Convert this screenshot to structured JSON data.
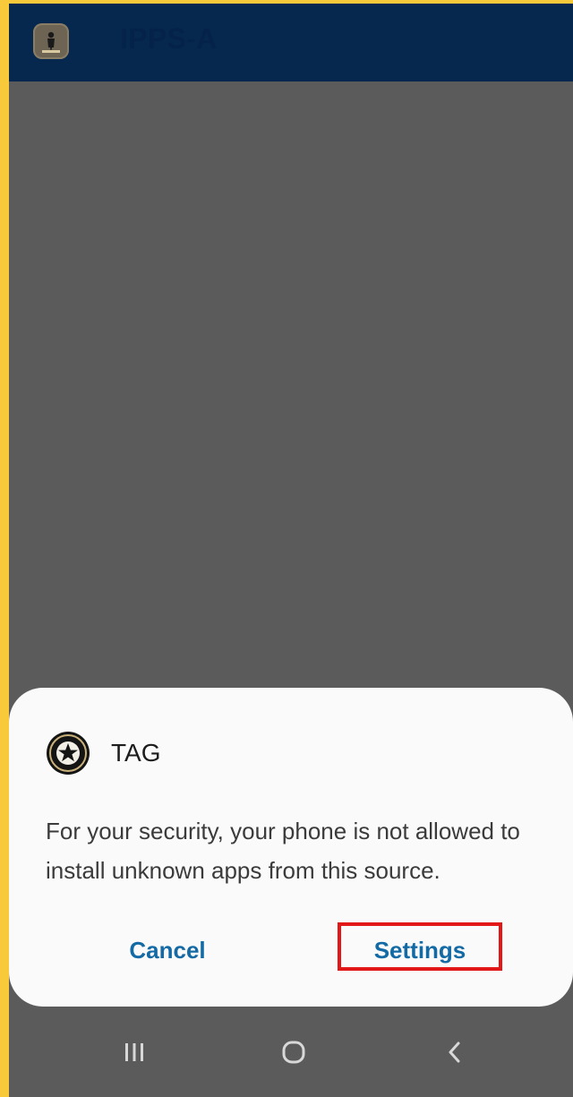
{
  "app_bar": {
    "title": "IPPS-A",
    "logo_icon": "ipps-a-logo-icon",
    "background": "#06284f"
  },
  "dialog": {
    "app_icon": "army-star-icon",
    "title": "TAG",
    "message": "For your security, your phone is not allowed to install unknown apps from this source.",
    "cancel_label": "Cancel",
    "settings_label": "Settings",
    "button_color": "#146aa5",
    "highlight_color": "#e21717"
  },
  "nav_bar": {
    "recents_icon": "recent-apps-icon",
    "home_icon": "home-icon",
    "back_icon": "back-icon"
  },
  "colors": {
    "border": "#f8c93b",
    "scrim": "#5b5b5b"
  }
}
